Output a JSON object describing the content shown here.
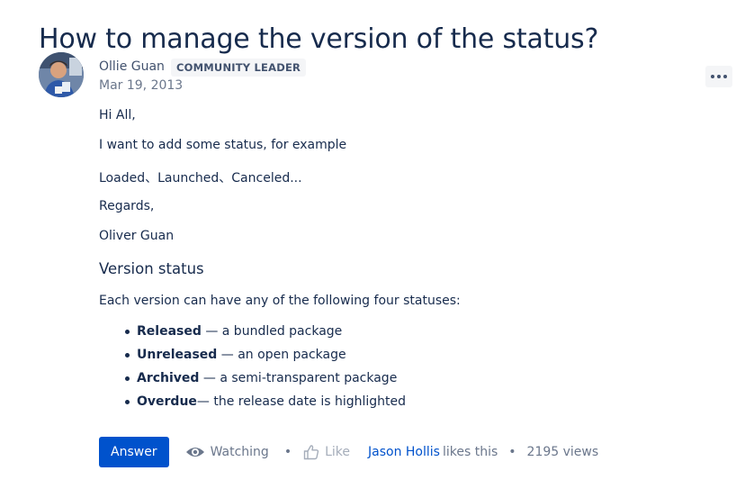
{
  "question": {
    "title": "How to manage the version of the status?"
  },
  "author": {
    "name": "Ollie Guan",
    "badge": "COMMUNITY LEADER",
    "date": "Mar 19, 2013"
  },
  "more_menu": {
    "icon": "more-horizontal-icon"
  },
  "body": {
    "paragraphs": [
      "Hi All,",
      "I want to add some status, for example",
      "Loaded、Launched、Canceled...",
      "Regards,",
      "Oliver Guan"
    ],
    "subheading": "Version status",
    "intro": "Each version can have any of the following four statuses:",
    "statuses": [
      {
        "name": "Released",
        "desc": " — a bundled package"
      },
      {
        "name": "Unreleased",
        "desc": " — an open package"
      },
      {
        "name": "Archived",
        "desc": " — a semi-transparent package"
      },
      {
        "name": "Overdue",
        "desc": "— the release date is highlighted"
      }
    ]
  },
  "footer": {
    "answer_label": "Answer",
    "watch_label": "Watching",
    "watch_icon": "eye-icon",
    "separator": "•",
    "like_label": "Like",
    "like_icon": "thumbs-up-icon",
    "liker": "Jason Hollis",
    "likes_suffix": "likes this",
    "views": "2195 views"
  },
  "colors": {
    "primary": "#0052cc",
    "text": "#172b4d",
    "muted": "#6b778c",
    "badge_bg": "#f4f5f7"
  }
}
